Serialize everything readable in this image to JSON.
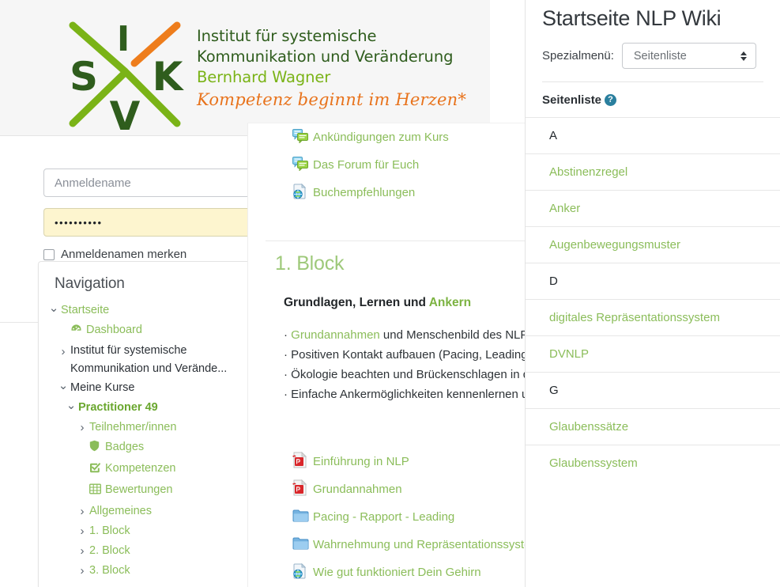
{
  "header": {
    "logo_icon": "isvk-cross-logo",
    "org_lines": [
      "Institut für systemische",
      "Kommunikation und Veränderung"
    ],
    "person": "Bernhard Wagner",
    "tagline": "Kompetenz beginnt im Herzen*",
    "colors": {
      "dark_green": "#2f5d1d",
      "light_green": "#7ab317",
      "orange": "#e8731c"
    }
  },
  "login": {
    "username_placeholder": "Anmeldename",
    "password_value": "••••••••••",
    "remember_label": "Anmeldenamen merken"
  },
  "navigation": {
    "title": "Navigation",
    "items": [
      {
        "label": "Startseite",
        "caret": "down",
        "icon": "",
        "depth": 0,
        "style": "link"
      },
      {
        "label": "Dashboard",
        "caret": "",
        "icon": "dashboard-icon",
        "depth": 1,
        "style": "link"
      },
      {
        "label": "Institut für systemische Kommunikation und Verände...",
        "caret": "right",
        "icon": "",
        "depth": 1,
        "style": "dark",
        "wrap": true
      },
      {
        "label": "Meine Kurse",
        "caret": "down",
        "icon": "",
        "depth": 1,
        "style": "dark"
      },
      {
        "label": "Practitioner 49",
        "caret": "down",
        "icon": "",
        "depth": 2,
        "style": "bold"
      },
      {
        "label": "Teilnehmer/innen",
        "caret": "right",
        "icon": "",
        "depth": 3,
        "style": "link"
      },
      {
        "label": "Badges",
        "caret": "",
        "icon": "badge-icon",
        "depth": 3,
        "style": "link"
      },
      {
        "label": "Kompetenzen",
        "caret": "",
        "icon": "checkbox-icon",
        "depth": 3,
        "style": "link"
      },
      {
        "label": "Bewertungen",
        "caret": "",
        "icon": "grid-icon",
        "depth": 3,
        "style": "link"
      },
      {
        "label": "Allgemeines",
        "caret": "right",
        "icon": "",
        "depth": 3,
        "style": "link"
      },
      {
        "label": "1. Block",
        "caret": "right",
        "icon": "",
        "depth": 3,
        "style": "link"
      },
      {
        "label": "2. Block",
        "caret": "right",
        "icon": "",
        "depth": 3,
        "style": "link"
      },
      {
        "label": "3. Block",
        "caret": "right",
        "icon": "",
        "depth": 3,
        "style": "link"
      }
    ]
  },
  "course": {
    "top_resources": [
      {
        "label": "Ankündigungen zum Kurs",
        "icon": "forum-icon"
      },
      {
        "label": "Das Forum für Euch",
        "icon": "forum-icon"
      },
      {
        "label": "Buchempfehlungen",
        "icon": "url-icon"
      }
    ],
    "section_title": "1. Block",
    "section_subtitle_plain": "Grundlagen, Lernen und ",
    "section_subtitle_link": "Ankern",
    "bullets": [
      {
        "lead": "Grundannahmen",
        "rest": " und Menschenbild des NLP"
      },
      {
        "lead": "",
        "rest": "Positiven Kontakt aufbauen (Pacing, Leading"
      },
      {
        "lead": "",
        "rest": "Ökologie beachten und Brückenschlagen in d"
      },
      {
        "lead": "",
        "rest": "Einfache Ankermöglichkeiten kennenlernen u"
      }
    ],
    "files": [
      {
        "label": "Einführung in NLP",
        "icon": "pdf-icon"
      },
      {
        "label": "Grundannahmen",
        "icon": "pdf-icon"
      },
      {
        "label": "Pacing - Rapport - Leading",
        "icon": "folder-icon"
      },
      {
        "label": "Wahrnehmung und Repräsentationssysteme",
        "icon": "folder-icon"
      },
      {
        "label": "Wie gut funktioniert Dein Gehirn",
        "icon": "url-icon"
      }
    ]
  },
  "wiki": {
    "title": "Startseite NLP Wiki",
    "menu_label": "Spezialmenü:",
    "select_value": "Seitenliste",
    "select_options": [
      "Seitenliste"
    ],
    "subheading": "Seitenliste",
    "help_icon_label": "?",
    "entries": [
      {
        "text": "A",
        "type": "letter"
      },
      {
        "text": "Abstinenzregel",
        "type": "page"
      },
      {
        "text": "Anker",
        "type": "page"
      },
      {
        "text": "Augenbewegungsmuster",
        "type": "page"
      },
      {
        "text": "D",
        "type": "letter"
      },
      {
        "text": "digitales Repräsentationssystem",
        "type": "page"
      },
      {
        "text": "DVNLP",
        "type": "page"
      },
      {
        "text": "G",
        "type": "letter"
      },
      {
        "text": "Glaubenssätze",
        "type": "page"
      },
      {
        "text": "Glaubenssystem",
        "type": "page"
      }
    ]
  }
}
